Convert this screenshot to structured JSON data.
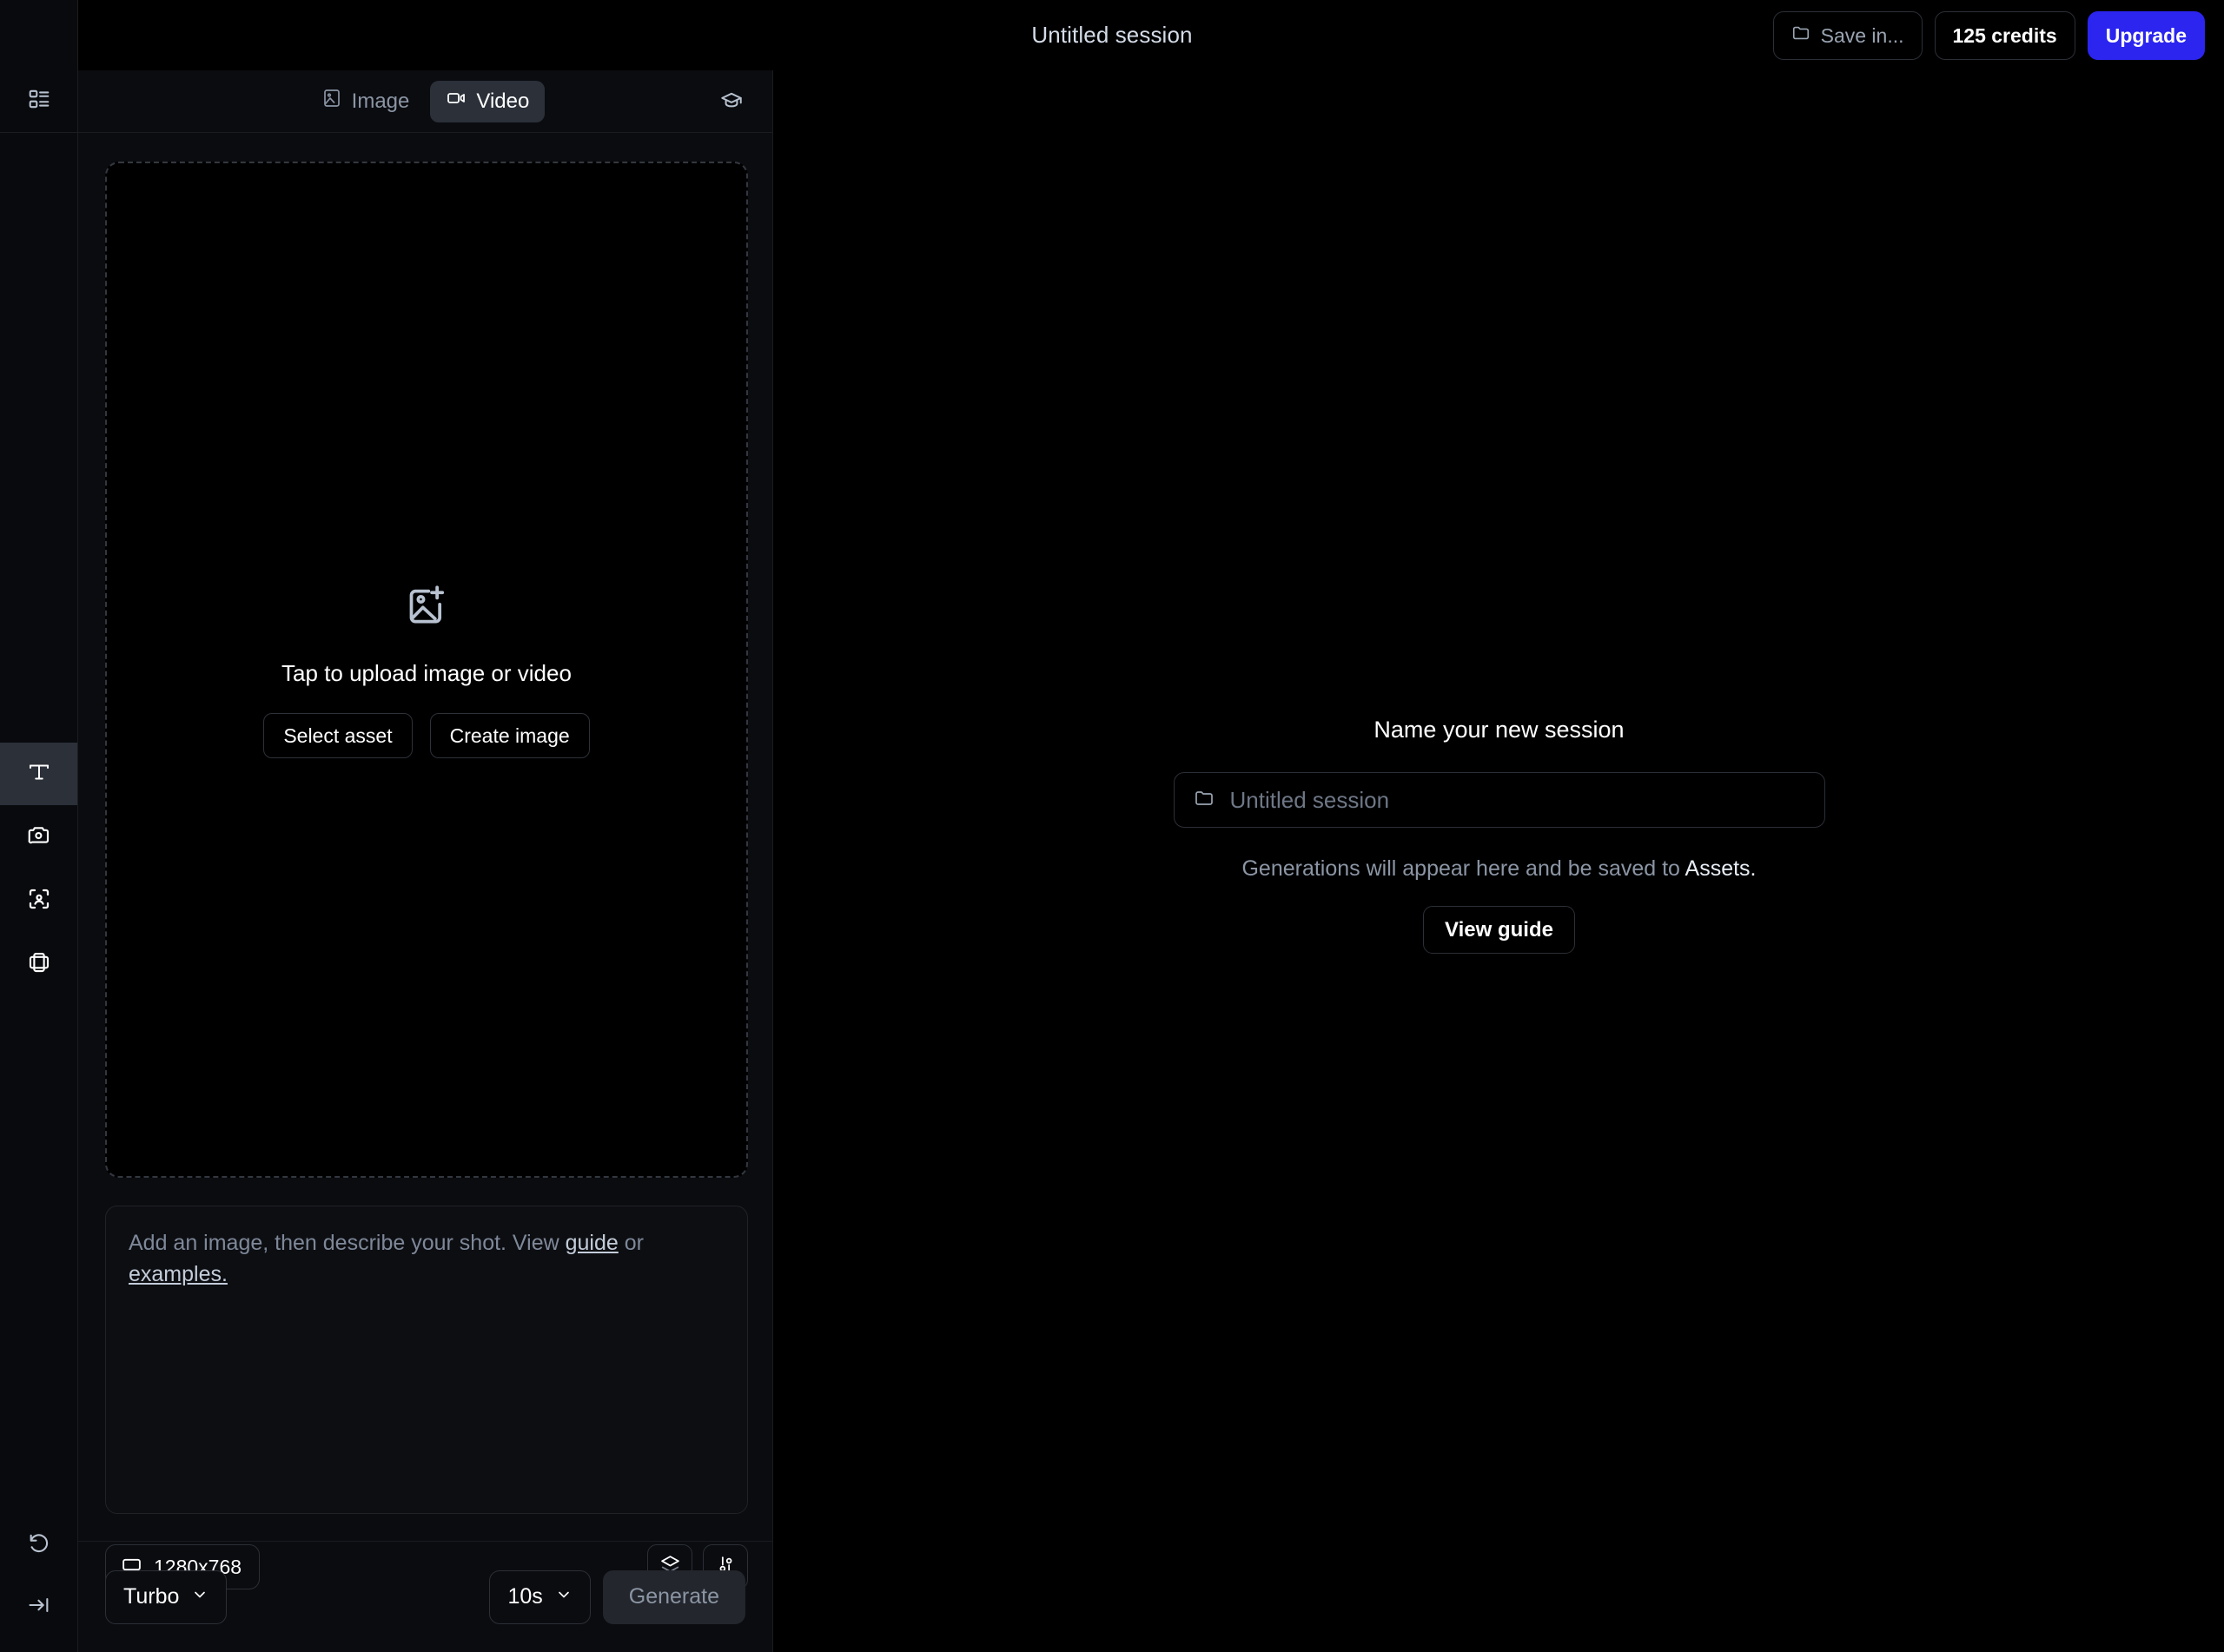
{
  "header": {
    "menu_icon": "hamburger-icon",
    "title": "Untitled session",
    "save_in_label": "Save in...",
    "save_in_icon": "folder-icon",
    "credits_label": "125 credits",
    "upgrade_label": "Upgrade",
    "upgrade_color": "#2b25ef"
  },
  "left_rail": {
    "top_icon": "panels-layout-icon",
    "tools": [
      {
        "name": "text-tool",
        "icon": "text-t-icon",
        "active": true
      },
      {
        "name": "camera-tool",
        "icon": "camera-icon",
        "active": false
      },
      {
        "name": "face-detect-tool",
        "icon": "face-scan-icon",
        "active": false
      },
      {
        "name": "frame-tool",
        "icon": "frame-layers-icon",
        "active": false
      }
    ],
    "bottom": [
      {
        "name": "reset-button",
        "icon": "undo-rotate-icon"
      },
      {
        "name": "collapse-panel-button",
        "icon": "arrow-to-line-icon"
      }
    ]
  },
  "panel": {
    "tabs": [
      {
        "label": "Image",
        "icon": "image-icon",
        "active": false
      },
      {
        "label": "Video",
        "icon": "video-camera-icon",
        "active": true
      }
    ],
    "learn_icon": "graduation-cap-icon",
    "dropzone": {
      "icon": "image-plus-icon",
      "text": "Tap to upload image or video",
      "buttons": [
        {
          "label": "Select asset"
        },
        {
          "label": "Create image"
        }
      ]
    },
    "prompt": {
      "placeholder_part1": "Add an image, then describe your shot. View ",
      "link_guide": "guide",
      "placeholder_part2": " or ",
      "link_examples": "examples.",
      "value": ""
    },
    "options": {
      "resolution_label": "1280x768",
      "resolution_icon": "aspect-ratio-icon",
      "layers_icon": "layers-icon",
      "settings_icon": "sliders-icon"
    },
    "bottom_bar": {
      "model_label": "Turbo",
      "duration_label": "10s",
      "generate_label": "Generate",
      "generate_disabled": true
    }
  },
  "canvas": {
    "heading": "Name your new session",
    "input_placeholder": "Untitled session",
    "input_value": "",
    "input_icon": "folder-icon",
    "subtext_prefix": "Generations will appear here and be saved to ",
    "subtext_strong": "Assets.",
    "view_guide_label": "View guide"
  }
}
